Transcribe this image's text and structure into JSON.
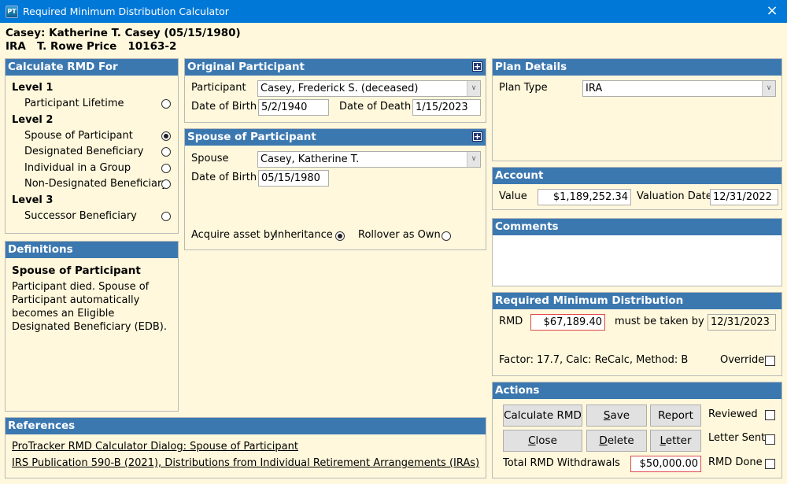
{
  "window": {
    "title": "Required Minimum Distribution Calculator",
    "app_icon": "PT",
    "close_icon": "×"
  },
  "header": {
    "line1": "Casey: Katherine T. Casey (05/15/1980)",
    "line2": "IRA   T. Rowe Price   10163-2"
  },
  "calculate_rmd_for": {
    "title": "Calculate RMD For",
    "levels": [
      {
        "label": "Level 1",
        "options": [
          {
            "label": "Participant Lifetime",
            "selected": false
          }
        ]
      },
      {
        "label": "Level 2",
        "options": [
          {
            "label": "Spouse of Participant",
            "selected": true
          },
          {
            "label": "Designated Beneficiary",
            "selected": false
          },
          {
            "label": "Individual in a Group",
            "selected": false
          },
          {
            "label": "Non-Designated Beneficiary",
            "selected": false
          }
        ]
      },
      {
        "label": "Level 3",
        "options": [
          {
            "label": "Successor Beneficiary",
            "selected": false
          }
        ]
      }
    ]
  },
  "definitions": {
    "title": "Definitions",
    "heading": "Spouse of Participant",
    "text": "Participant died. Spouse of Participant automatically becomes an Eligible Designated Beneficiary (EDB)."
  },
  "original_participant": {
    "title": "Original Participant",
    "participant_label": "Participant",
    "participant_value": "Casey, Frederick S. (deceased)",
    "dob_label": "Date of Birth",
    "dob_value": "5/2/1940",
    "dod_label": "Date of Death",
    "dod_value": "1/15/2023"
  },
  "spouse_of_participant": {
    "title": "Spouse of Participant",
    "spouse_label": "Spouse",
    "spouse_value": "Casey, Katherine T.",
    "dob_label": "Date of Birth",
    "dob_value": "05/15/1980",
    "acquire_label": "Acquire asset by",
    "inheritance_label": "Inheritance",
    "inheritance_selected": true,
    "rollover_label": "Rollover as Own",
    "rollover_selected": false
  },
  "plan_details": {
    "title": "Plan Details",
    "plan_type_label": "Plan Type",
    "plan_type_value": "IRA"
  },
  "account": {
    "title": "Account",
    "value_label": "Value",
    "value": "$1,189,252.34",
    "valuation_date_label": "Valuation Date",
    "valuation_date": "12/31/2022"
  },
  "comments": {
    "title": "Comments",
    "value": ""
  },
  "rmd": {
    "title": "Required Minimum Distribution",
    "rmd_label": "RMD",
    "rmd_value": "$67,189.40",
    "taken_by_label": "must be taken by",
    "taken_by_date": "12/31/2023",
    "factor_text": "Factor: 17.7, Calc: ReCalc, Method: B",
    "override_label": "Override",
    "override_checked": false
  },
  "actions": {
    "title": "Actions",
    "buttons": {
      "calculate": "Calculate RMD",
      "save": "Save",
      "report": "Report",
      "close": "Close",
      "delete": "Delete",
      "letter": "Letter"
    },
    "total_label": "Total RMD Withdrawals",
    "total_value": "$50,000.00",
    "reviewed_label": "Reviewed",
    "letter_sent_label": "Letter Sent",
    "rmd_done_label": "RMD Done"
  },
  "references": {
    "title": "References",
    "links": [
      "ProTracker RMD Calculator Dialog: Spouse of Participant",
      "IRS Publication 590-B (2021), Distributions from Individual Retirement Arrangements (IRAs)"
    ]
  },
  "colors": {
    "titlebar": "#0078d7",
    "panel_header": "#3c78b0",
    "background": "#fff8dc",
    "highlight_border": "#e04848"
  }
}
